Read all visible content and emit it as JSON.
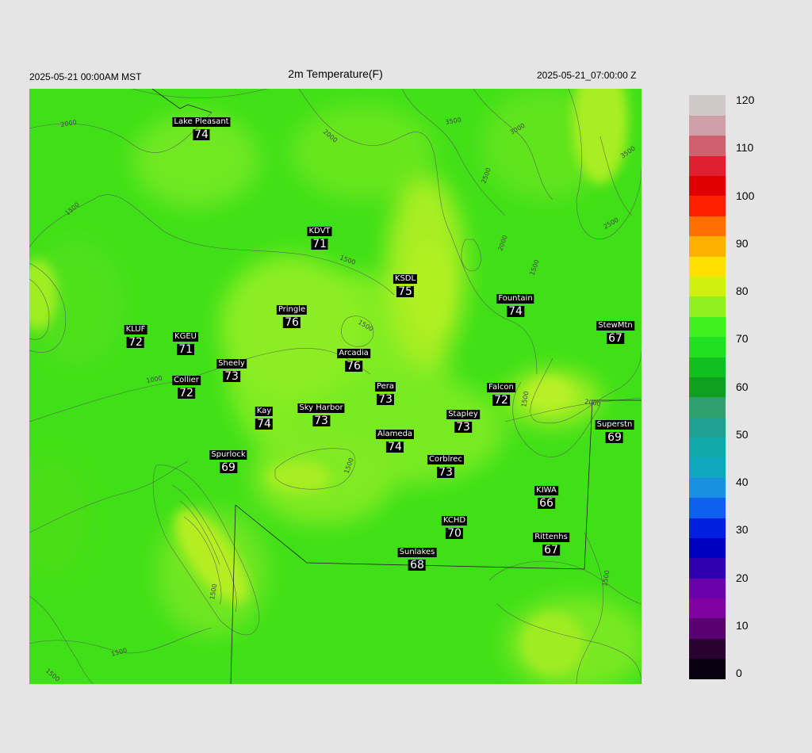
{
  "header": {
    "title": "2m Temperature(F)",
    "local_time": "2025-05-21 00:00AM MST",
    "utc_time": "2025-05-21_07:00:00 Z"
  },
  "stations": [
    {
      "name": "Lake Pleasant",
      "temp": "74"
    },
    {
      "name": "KDVT",
      "temp": "71"
    },
    {
      "name": "KSDL",
      "temp": "75"
    },
    {
      "name": "Fountain",
      "temp": "74"
    },
    {
      "name": "Pringle",
      "temp": "76"
    },
    {
      "name": "StewMtn",
      "temp": "67"
    },
    {
      "name": "KLUF",
      "temp": "72"
    },
    {
      "name": "KGEU",
      "temp": "71"
    },
    {
      "name": "Arcadia",
      "temp": "76"
    },
    {
      "name": "Sheely",
      "temp": "73"
    },
    {
      "name": "Collier",
      "temp": "72"
    },
    {
      "name": "Pera",
      "temp": "73"
    },
    {
      "name": "Falcon",
      "temp": "72"
    },
    {
      "name": "Kay",
      "temp": "74"
    },
    {
      "name": "Sky Harbor",
      "temp": "73"
    },
    {
      "name": "Stapley",
      "temp": "73"
    },
    {
      "name": "Superstn",
      "temp": "69"
    },
    {
      "name": "Alameda",
      "temp": "74"
    },
    {
      "name": "Spurlock",
      "temp": "69"
    },
    {
      "name": "Corblrec",
      "temp": "73"
    },
    {
      "name": "KIWA",
      "temp": "66"
    },
    {
      "name": "KCHD",
      "temp": "70"
    },
    {
      "name": "Rittenhs",
      "temp": "67"
    },
    {
      "name": "Sunlakes",
      "temp": "68"
    }
  ],
  "contour_labels": [
    "2000",
    "2000",
    "3500",
    "3000",
    "3500",
    "2500",
    "2000",
    "2500",
    "1500",
    "1500",
    "1500",
    "1500",
    "1000",
    "1500",
    "2000",
    "1500",
    "1500",
    "1500",
    "1500",
    "1500"
  ],
  "colorbar": {
    "ticks": [
      "120",
      "110",
      "100",
      "90",
      "80",
      "70",
      "60",
      "50",
      "40",
      "30",
      "20",
      "10",
      "0"
    ],
    "min": 0,
    "max": 120,
    "colors": [
      "#0a0010",
      "#2a0030",
      "#5a0070",
      "#8000a0",
      "#6a00a8",
      "#3000b0",
      "#0000c0",
      "#0020e0",
      "#1060f0",
      "#1a90e0",
      "#10a8c0",
      "#10a8a8",
      "#20a090",
      "#30a070",
      "#10a020",
      "#10c020",
      "#20e020",
      "#40f020",
      "#90f020",
      "#d0f010",
      "#ffe000",
      "#ffb000",
      "#ff7000",
      "#ff2000",
      "#e00000",
      "#e02030",
      "#d06070",
      "#d0a0a8",
      "#d0c8c8"
    ]
  }
}
